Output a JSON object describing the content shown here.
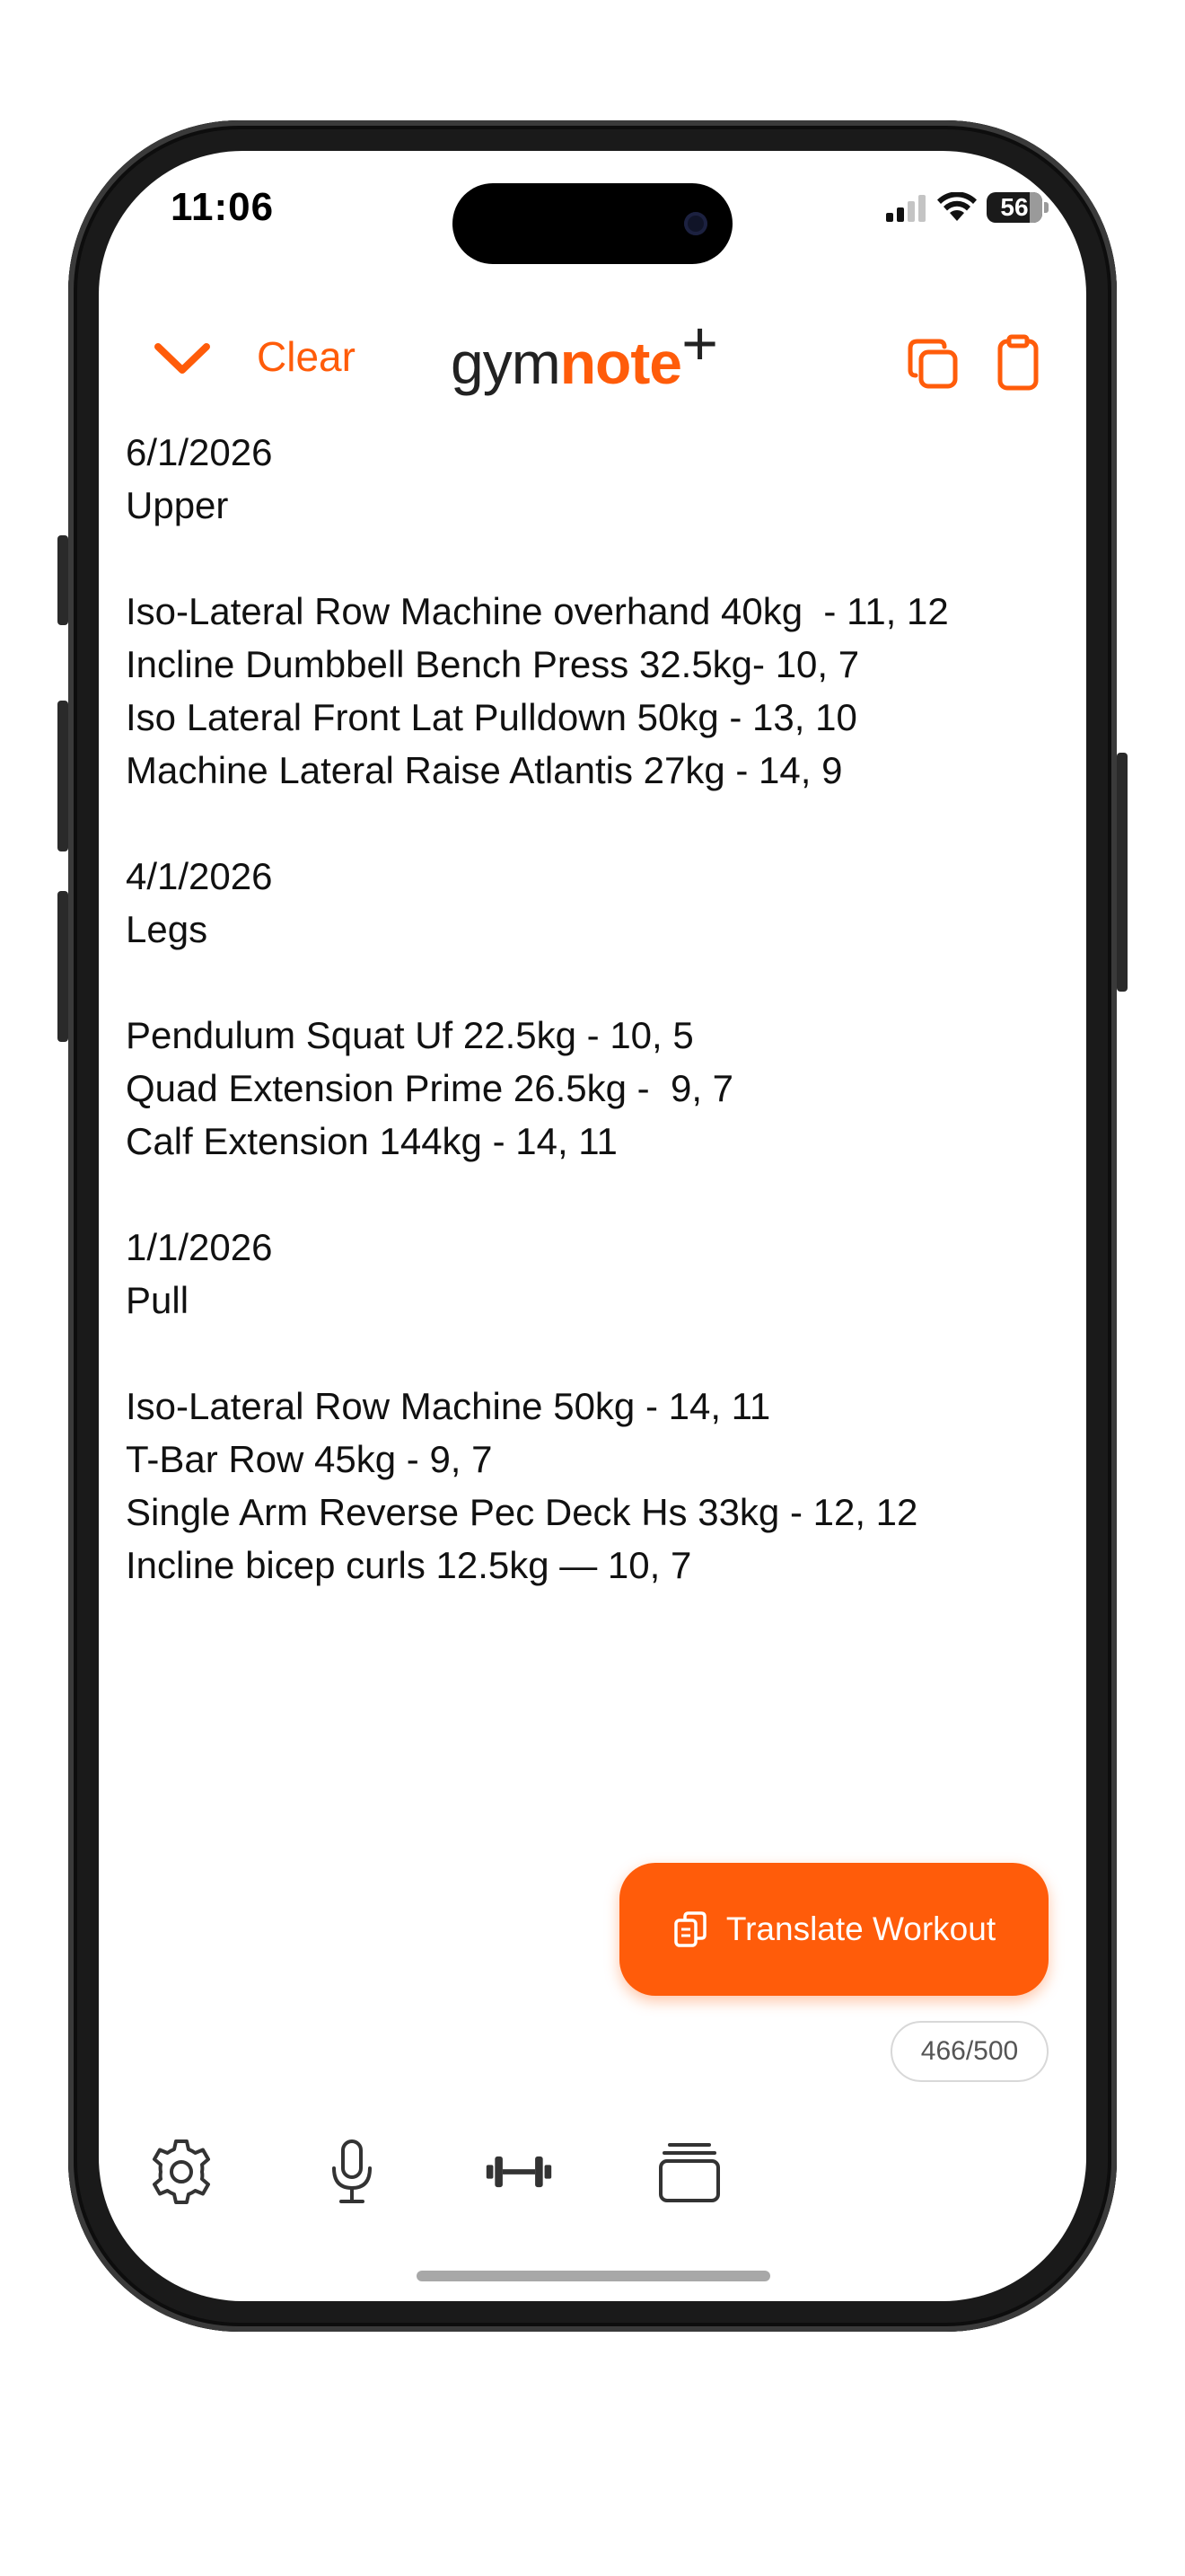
{
  "status_bar": {
    "time": "11:06",
    "battery": "56"
  },
  "header": {
    "clear_label": "Clear",
    "logo_part1": "gym",
    "logo_part2": "note",
    "logo_plus": "+"
  },
  "note": {
    "lines": [
      "6/1/2026",
      "Upper",
      "",
      "Iso-Lateral Row Machine overhand 40kg  - 11, 12",
      "Incline Dumbbell Bench Press 32.5kg- 10, 7",
      "Iso Lateral Front Lat Pulldown 50kg - 13, 10",
      "Machine Lateral Raise Atlantis 27kg - 14, 9",
      "",
      "4/1/2026",
      "Legs",
      "",
      "Pendulum Squat Uf 22.5kg - 10, 5",
      "Quad Extension Prime 26.5kg -  9, 7",
      "Calf Extension 144kg - 14, 11",
      "",
      "1/1/2026",
      "Pull",
      "",
      "Iso-Lateral Row Machine 50kg - 14, 11",
      "T-Bar Row 45kg - 9, 7",
      "Single Arm Reverse Pec Deck Hs 33kg - 12, 12",
      "Incline bicep curls 12.5kg — 10, 7"
    ]
  },
  "translate_button": {
    "label": "Translate Workout"
  },
  "char_count": "466/500",
  "toolbar": {
    "icons": [
      "gear-icon",
      "microphone-icon",
      "dumbbell-icon",
      "stack-icon"
    ]
  },
  "colors": {
    "accent": "#ff5c0a",
    "text": "#111111",
    "icon": "#333333"
  }
}
